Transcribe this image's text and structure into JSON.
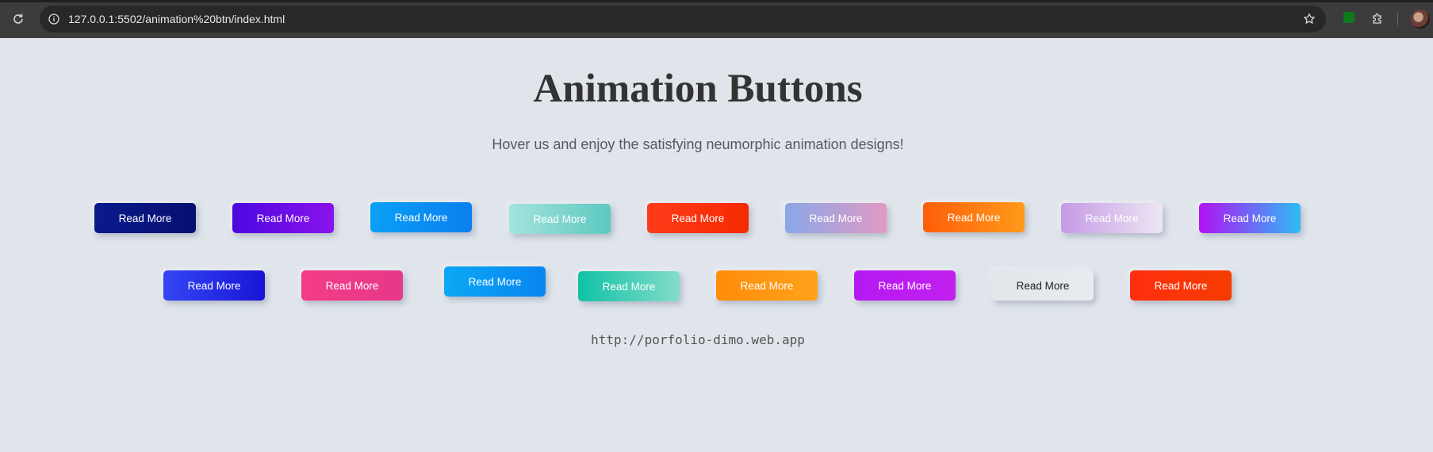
{
  "browser": {
    "url": "127.0.0.1:5502/animation%20btn/index.html"
  },
  "page": {
    "title": "Animation Buttons",
    "subtitle": "Hover us and enjoy the satisfying neumorphic animation designs!",
    "footer_link": "http://porfolio-dimo.web.app"
  },
  "buttons": {
    "row1": [
      {
        "label": "Read More",
        "colors": [
          "#0a1a8c",
          "#061070"
        ]
      },
      {
        "label": "Read More",
        "colors": [
          "#4c07e0",
          "#8a12ec"
        ]
      },
      {
        "label": "Read More",
        "colors": [
          "#0aa0f5",
          "#0b7ff0"
        ]
      },
      {
        "label": "Read More",
        "colors": [
          "#a5e3dd",
          "#5cc9c0"
        ]
      },
      {
        "label": "Read More",
        "colors": [
          "#ff3b1a",
          "#f52a00"
        ]
      },
      {
        "label": "Read More",
        "colors": [
          "#8aa7e8",
          "#e19ac3"
        ]
      },
      {
        "label": "Read More",
        "colors": [
          "#ff5e0a",
          "#ff9a1a"
        ]
      },
      {
        "label": "Read More",
        "colors": [
          "#c59ae6",
          "#ece6f3"
        ]
      },
      {
        "label": "Read More",
        "colors": [
          "#b112f5",
          "#2ebcf5"
        ]
      }
    ],
    "row2": [
      {
        "label": "Read More",
        "colors": [
          "#3346f5",
          "#1a14d6"
        ]
      },
      {
        "label": "Read More",
        "colors": [
          "#f23c86",
          "#e8388a"
        ]
      },
      {
        "label": "Read More",
        "colors": [
          "#0ba8f5",
          "#0a85f0"
        ]
      },
      {
        "label": "Read More",
        "colors": [
          "#0fc2a5",
          "#84dccb"
        ]
      },
      {
        "label": "Read More",
        "colors": [
          "#ff8c0a",
          "#ffa21a"
        ]
      },
      {
        "label": "Read More",
        "colors": [
          "#b41af2",
          "#c21fee"
        ]
      },
      {
        "label": "Read More",
        "colors": [
          "#e2e6eb",
          "#e8ebef"
        ],
        "text_color": "#222222"
      },
      {
        "label": "Read More",
        "colors": [
          "#ff2e10",
          "#f53c00"
        ]
      }
    ]
  }
}
